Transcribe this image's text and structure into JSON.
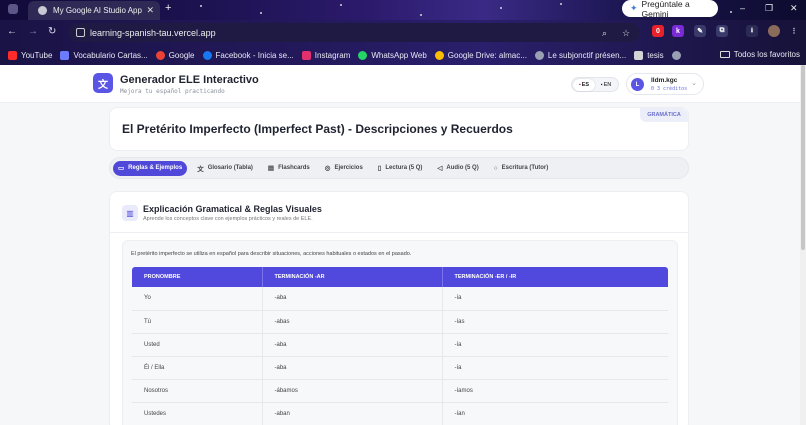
{
  "browser": {
    "tab_title": "My Google AI Studio App",
    "tab_close": "✕",
    "new_tab": "+",
    "gemini_button": "Pregúntale a Gemini",
    "url": "learning-spanish-tau.vercel.app",
    "ext_badges": [
      "0",
      "k"
    ],
    "bookmarks": [
      {
        "label": "YouTube",
        "color": "#ff2b2b"
      },
      {
        "label": "Vocabulario Cartas...",
        "color": "#6b7cff"
      },
      {
        "label": "Google",
        "color": "#ea4335"
      },
      {
        "label": "Facebook - Inicia se...",
        "color": "#1877f2"
      },
      {
        "label": "Instagram",
        "color": "#e1306c"
      },
      {
        "label": "WhatsApp Web",
        "color": "#25d366"
      },
      {
        "label": "Google Drive: almac...",
        "color": "#fbbc04"
      },
      {
        "label": "Le subjonctif présen...",
        "color": "#9aa0b4"
      },
      {
        "label": "tesis",
        "color": "#d4d4d4"
      }
    ],
    "bookmarks_right": "Todos los favoritos"
  },
  "header": {
    "title": "Generador ELE Interactivo",
    "subtitle": "Mejora tu español practicando",
    "lang_es": "ES",
    "lang_en": "EN",
    "user_initial": "L",
    "user_name": "lldm.kgc",
    "user_credits": "0 3 créditos"
  },
  "lesson": {
    "title": "El Pretérito Imperfecto (Imperfect Past) - Descripciones y Recuerdos",
    "badge": "GRAMÁTICA"
  },
  "tabs": [
    {
      "label": "Reglas & Ejemplos",
      "icon": "book-icon",
      "active": true
    },
    {
      "label": "Glosario (Tabla)",
      "icon": "translate-icon",
      "active": false
    },
    {
      "label": "Flashcards",
      "icon": "cards-icon",
      "active": false
    },
    {
      "label": "Ejercicios",
      "icon": "check-circle-icon",
      "active": false
    },
    {
      "label": "Lectura (5 Q)",
      "icon": "document-icon",
      "active": false
    },
    {
      "label": "Audio (5 Q)",
      "icon": "speaker-icon",
      "active": false
    },
    {
      "label": "Escritura (Tutor)",
      "icon": "chat-icon",
      "active": false
    }
  ],
  "section": {
    "title": "Explicación Gramatical & Reglas Visuales",
    "subtitle": "Aprende los conceptos clave con ejemplos prácticos y reales de ELE.",
    "intro": "El pretérito imperfecto se utiliza en español para describir situaciones, acciones habituales o estados en el pasado."
  },
  "table": {
    "headers": [
      "PRONOMBRE",
      "TERMINACIÓN -AR",
      "TERMINACIÓN -ER / -IR"
    ],
    "rows": [
      [
        "Yo",
        "-aba",
        "-ía"
      ],
      [
        "Tú",
        "-abas",
        "-ías"
      ],
      [
        "Usted",
        "-aba",
        "-ía"
      ],
      [
        "Él / Ella",
        "-aba",
        "-ía"
      ],
      [
        "Nosotros",
        "-ábamos",
        "-íamos"
      ],
      [
        "Ustedes",
        "-aban",
        "-ían"
      ]
    ]
  },
  "colors": {
    "accent": "#5149dd",
    "badge_text": "#6a70c9"
  }
}
